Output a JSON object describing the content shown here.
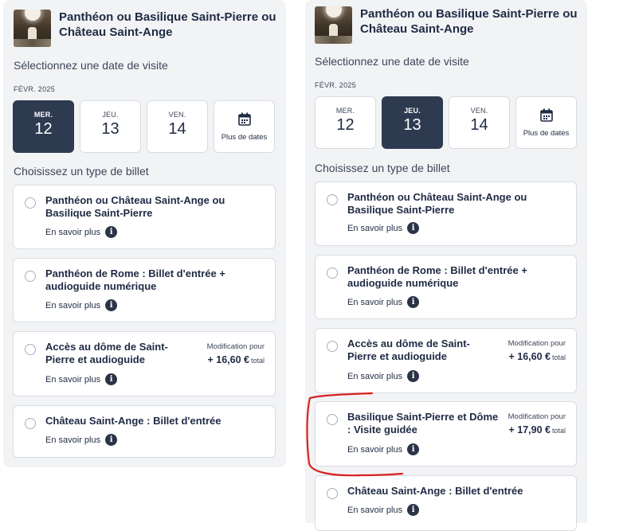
{
  "product_title": "Panthéon ou Basilique Saint-Pierre ou Château Saint-Ange",
  "select_date_label": "Sélectionnez une date de visite",
  "month_label": "FÉVR. 2025",
  "dates": [
    {
      "dow": "MER.",
      "day": "12"
    },
    {
      "dow": "JEU.",
      "day": "13"
    },
    {
      "dow": "VEN.",
      "day": "14"
    }
  ],
  "more_dates_label": "Plus de dates",
  "ticket_type_label": "Choisissez un type de billet",
  "learn_more": "En savoir plus",
  "price_note": "Modification pour",
  "total_label": "total",
  "tickets": {
    "pantheon_chateau_basilique": "Panthéon ou Château Saint-Ange ou Basilique Saint-Pierre",
    "pantheon_rome": "Panthéon de Rome : Billet d'entrée + audioguide numérique",
    "dome": "Accès au dôme de Saint-Pierre et audioguide",
    "dome_price": "+ 16,60 €",
    "basilique_visite": "Basilique Saint-Pierre et Dôme : Visite guidée",
    "basilique_price": "+ 17,90 €",
    "chateau": "Château Saint-Ange : Billet d'entrée"
  },
  "panels": {
    "left_selected_day": "12",
    "right_selected_day": "13"
  },
  "colors": {
    "selected_date_bg": "#2e3a50",
    "panel_bg": "#f2f3f5",
    "annotation_red": "#d9201f"
  },
  "icons": [
    "calendar-icon",
    "info-icon",
    "radio-button"
  ]
}
